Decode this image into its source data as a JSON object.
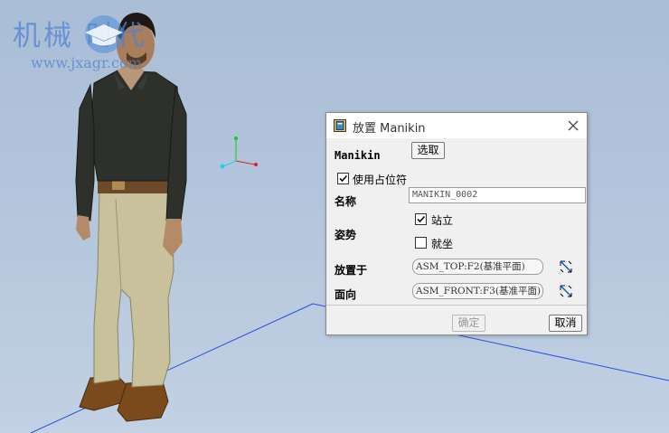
{
  "watermark": {
    "title": "机械 时代",
    "url": "www.jxagr.com"
  },
  "dialog": {
    "title": "放置 Manikin",
    "manikin_label": "Manikin",
    "select_button": "选取",
    "use_placeholder": {
      "label": "使用占位符",
      "checked": true
    },
    "name_label": "名称",
    "name_value": "MANIKIN_0002",
    "posture_label": "姿势",
    "posture_options": [
      {
        "label": "站立",
        "checked": true
      },
      {
        "label": "就坐",
        "checked": false
      }
    ],
    "place_on_label": "放置于",
    "place_on_value": "ASM_TOP:F2(基准平面)",
    "facing_label": "面向",
    "facing_value": "ASM_FRONT:F3(基准平面)",
    "ok_button": "确定",
    "cancel_button": "取消"
  },
  "colors": {
    "viewport_bg": "#b3c5dc",
    "datum_line": "#2d4fe0",
    "axis_x": "#e02020",
    "axis_y": "#20c030",
    "axis_z": "#20d0e0"
  },
  "icons": {
    "title": "manikin-app-icon",
    "close": "close-icon",
    "flip": "flip-direction-icon"
  }
}
